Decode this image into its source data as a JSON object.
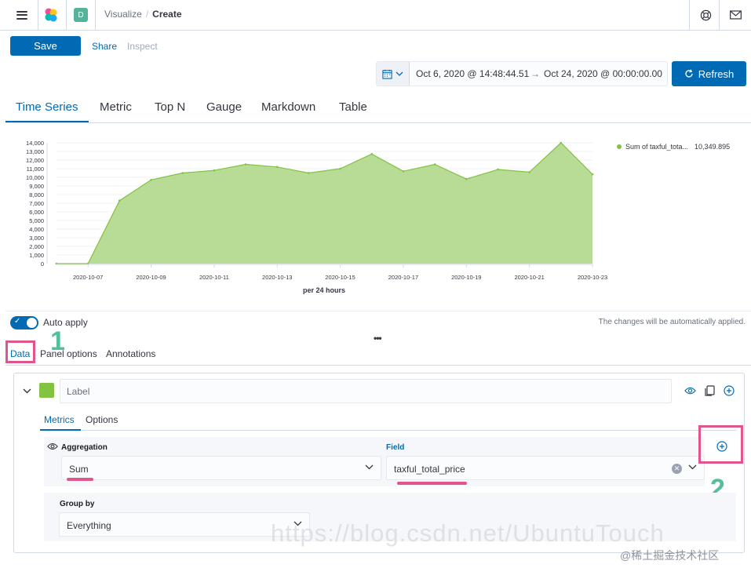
{
  "header": {
    "space_letter": "D",
    "breadcrumbs": [
      "Visualize",
      "Create"
    ]
  },
  "toolbar": {
    "save_label": "Save",
    "share_label": "Share",
    "inspect_label": "Inspect"
  },
  "time_picker": {
    "start": "Oct 6, 2020 @ 14:48:44.51",
    "arrow": "→",
    "end": "Oct 24, 2020 @ 00:00:00.00",
    "refresh_label": "Refresh"
  },
  "tsvb_tabs": [
    "Time Series",
    "Metric",
    "Top N",
    "Gauge",
    "Markdown",
    "Table"
  ],
  "chart_data": {
    "type": "area",
    "x": [
      "2020-10-06",
      "2020-10-07",
      "2020-10-08",
      "2020-10-09",
      "2020-10-10",
      "2020-10-11",
      "2020-10-12",
      "2020-10-13",
      "2020-10-14",
      "2020-10-15",
      "2020-10-16",
      "2020-10-17",
      "2020-10-18",
      "2020-10-19",
      "2020-10-20",
      "2020-10-21",
      "2020-10-22",
      "2020-10-23"
    ],
    "x_tick_labels": [
      "2020-10-07",
      "2020-10-09",
      "2020-10-11",
      "2020-10-13",
      "2020-10-15",
      "2020-10-17",
      "2020-10-19",
      "2020-10-21",
      "2020-10-23"
    ],
    "y_tick_labels": [
      "0",
      "1,000",
      "2,000",
      "3,000",
      "4,000",
      "5,000",
      "6,000",
      "7,000",
      "8,000",
      "9,000",
      "10,000",
      "11,000",
      "12,000",
      "13,000",
      "14,000"
    ],
    "series": [
      {
        "name": "Sum of taxful_tota...",
        "values": [
          0,
          0,
          7300,
          9700,
          10500,
          10800,
          11500,
          11200,
          10500,
          11000,
          12700,
          10700,
          11500,
          9800,
          10900,
          10600,
          14000,
          10350
        ]
      }
    ],
    "ylim": [
      0,
      14000
    ],
    "xlabel": "per 24 hours",
    "ylabel": "",
    "legend_value": "10,349.895",
    "legend_position": "right",
    "color": "#82c341",
    "grid": true
  },
  "editor": {
    "auto_apply_label": "Auto apply",
    "auto_apply_on": true,
    "auto_apply_note": "The changes will be automatically applied.",
    "drag_handle": "•••",
    "tabs": [
      "Data",
      "Panel options",
      "Annotations"
    ],
    "series": {
      "label_placeholder": "Label",
      "color": "#82c341",
      "inner_tabs": [
        "Metrics",
        "Options"
      ],
      "aggregation_label": "Aggregation",
      "aggregation_value": "Sum",
      "field_label": "Field",
      "field_value": "taxful_total_price",
      "group_by_label": "Group by",
      "group_by_value": "Everything"
    }
  },
  "annotations": {
    "one": "1",
    "two": "2",
    "color": "#e0568c",
    "number_color": "#53bf9d"
  },
  "watermark": {
    "small": "@稀土掘金技术社区",
    "big": "https://blog.csdn.net/UbuntuTouch"
  }
}
